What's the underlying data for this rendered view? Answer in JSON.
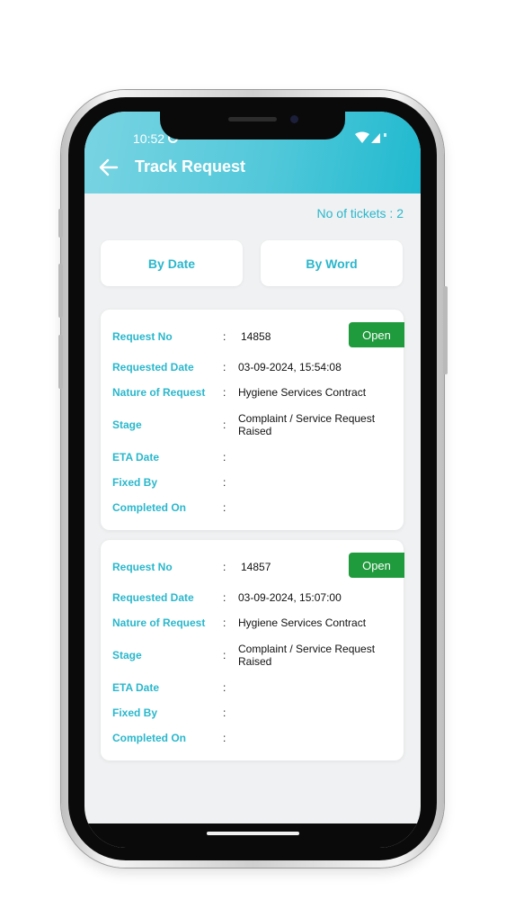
{
  "status_bar": {
    "time": "10:52"
  },
  "header": {
    "title": "Track Request"
  },
  "tickets": {
    "count_label": "No of tickets : 2"
  },
  "filters": {
    "by_date": "By Date",
    "by_word": "By Word"
  },
  "fields": {
    "request_no": "Request No",
    "requested_date": "Requested Date",
    "nature": "Nature of Request",
    "stage": "Stage",
    "eta": "ETA Date",
    "fixed_by": "Fixed By",
    "completed_on": "Completed On",
    "separator": ":"
  },
  "requests": [
    {
      "request_no": "14858",
      "status": "Open",
      "requested_date": "03-09-2024, 15:54:08",
      "nature": "Hygiene Services Contract",
      "stage": "Complaint / Service Request Raised",
      "eta": "",
      "fixed_by": "",
      "completed_on": ""
    },
    {
      "request_no": "14857",
      "status": "Open",
      "requested_date": "03-09-2024, 15:07:00",
      "nature": "Hygiene Services Contract",
      "stage": "Complaint / Service Request Raised",
      "eta": "",
      "fixed_by": "",
      "completed_on": ""
    }
  ],
  "icons": {
    "back": "arrow-left-icon",
    "wifi": "wifi-icon",
    "signal": "signal-icon",
    "status_circle": "status-circle-icon"
  },
  "colors": {
    "accent": "#2ab7cc",
    "header_start": "#79d4e2",
    "header_end": "#20b9cf",
    "status_open": "#1f9a3c",
    "background": "#eff1f2"
  }
}
